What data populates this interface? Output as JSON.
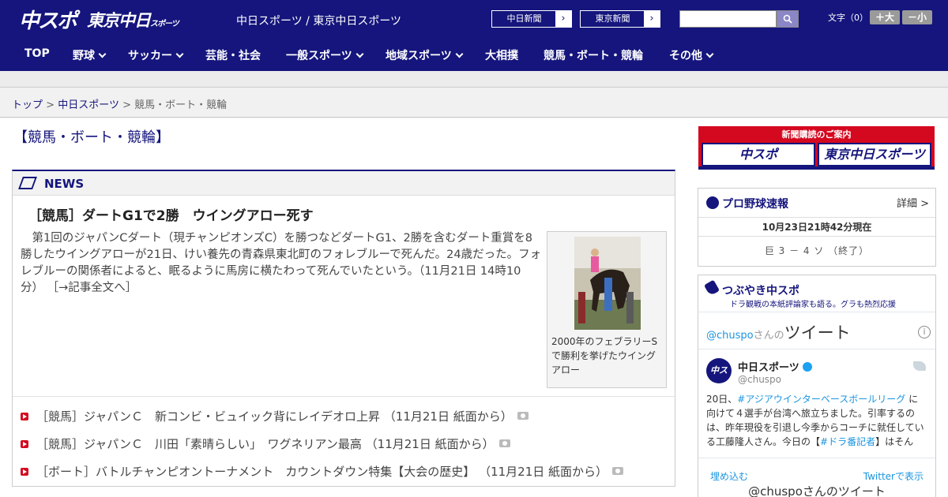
{
  "header": {
    "logo_chuspo": "中スポ",
    "logo_tokyo": "東京中日",
    "logo_tokyo_sub": "スポーツ",
    "site_names": "中日スポーツ / 東京中日スポーツ",
    "paper_links": [
      "中日新聞",
      "東京新聞"
    ],
    "search_icon": "search-icon",
    "font_size_label": "文字（0）",
    "font_larger": "＋大",
    "font_smaller": "－小"
  },
  "nav": {
    "items": [
      {
        "label": "TOP",
        "dropdown": false
      },
      {
        "label": "野球",
        "dropdown": true
      },
      {
        "label": "サッカー",
        "dropdown": true
      },
      {
        "label": "芸能・社会",
        "dropdown": false
      },
      {
        "label": "一般スポーツ",
        "dropdown": true
      },
      {
        "label": "地域スポーツ",
        "dropdown": true
      },
      {
        "label": "大相撲",
        "dropdown": false
      },
      {
        "label": "競馬・ボート・競輪",
        "dropdown": false
      },
      {
        "label": "その他",
        "dropdown": true
      }
    ]
  },
  "breadcrumb": {
    "home": "トップ",
    "section": "中日スポーツ",
    "current": "競馬・ボート・競輪",
    "separator": ">"
  },
  "page": {
    "title": "【競馬・ボート・競輪】"
  },
  "news": {
    "label": "NEWS",
    "headline": "［競馬］ダートG1で2勝　ウイングアロー死す",
    "body": "第1回のジャパンCダート（現チャンピオンズC）を勝つなどダートG1、2勝を含むダート重賞を8勝したウイングアローが21日、けい養先の青森県東北町のフォレブルーで死んだ。24歳だった。フォレブルーの関係者によると、眠るように馬房に横たわって死んでいたという。（11月21日 14時10分）",
    "full_article_link": "［→記事全文へ］",
    "photo_caption": "2000年のフェブラリーSで勝利を挙げたウイングアロー",
    "list": [
      "［競馬］ジャパンＣ　新コンビ・ビュイック背にレイデオロ上昇 （11月21日 紙面から）",
      "［競馬］ジャパンＣ　川田「素晴らしい」　ワグネリアン最高 （11月21日 紙面から）",
      "［ボート］バトルチャンピオントーナメント　カウントダウン特集【大会の歴史】 （11月21日 紙面から）"
    ]
  },
  "sidebar": {
    "subscribe_title": "新聞購読のご案内",
    "subscribe_logos": [
      "中スポ",
      "東京中日スポーツ"
    ],
    "baseball": {
      "title": "プロ野球速報",
      "more": "詳細 >",
      "time": "10月23日21時42分現在",
      "score": "巨 3 － 4 ソ （終了）"
    },
    "tweets": {
      "title": "つぶやき中スポ",
      "subtitle": "ドラ観戦の本紙評論家も語る。グラも熱烈応援",
      "header_handle": "@chuspo",
      "header_san": "さんの",
      "header_tweet": "ツイート",
      "avatar": "中スポ",
      "name": "中日スポーツ",
      "user": "@chuspo",
      "text_parts": [
        {
          "t": "20日、",
          "tag": false
        },
        {
          "t": "#アジアウインターベースボールリーグ",
          "tag": true
        },
        {
          "t": " に向けて４選手が台湾へ旅立ちました。引率するのは、昨年現役を引退し今季からコーチに就任している工藤隆人さん。今日の【",
          "tag": false
        },
        {
          "t": "#ドラ番記者",
          "tag": true
        },
        {
          "t": "】はそんな”新米",
          "tag": false
        }
      ],
      "embed": "埋め込む",
      "view_on_twitter": "Twitterで表示",
      "bottom": "@chuspoさんのツイート"
    }
  },
  "colors": {
    "brand_navy": "#15157d",
    "accent_red": "#d4081f",
    "link_blue": "#1b95e0"
  }
}
